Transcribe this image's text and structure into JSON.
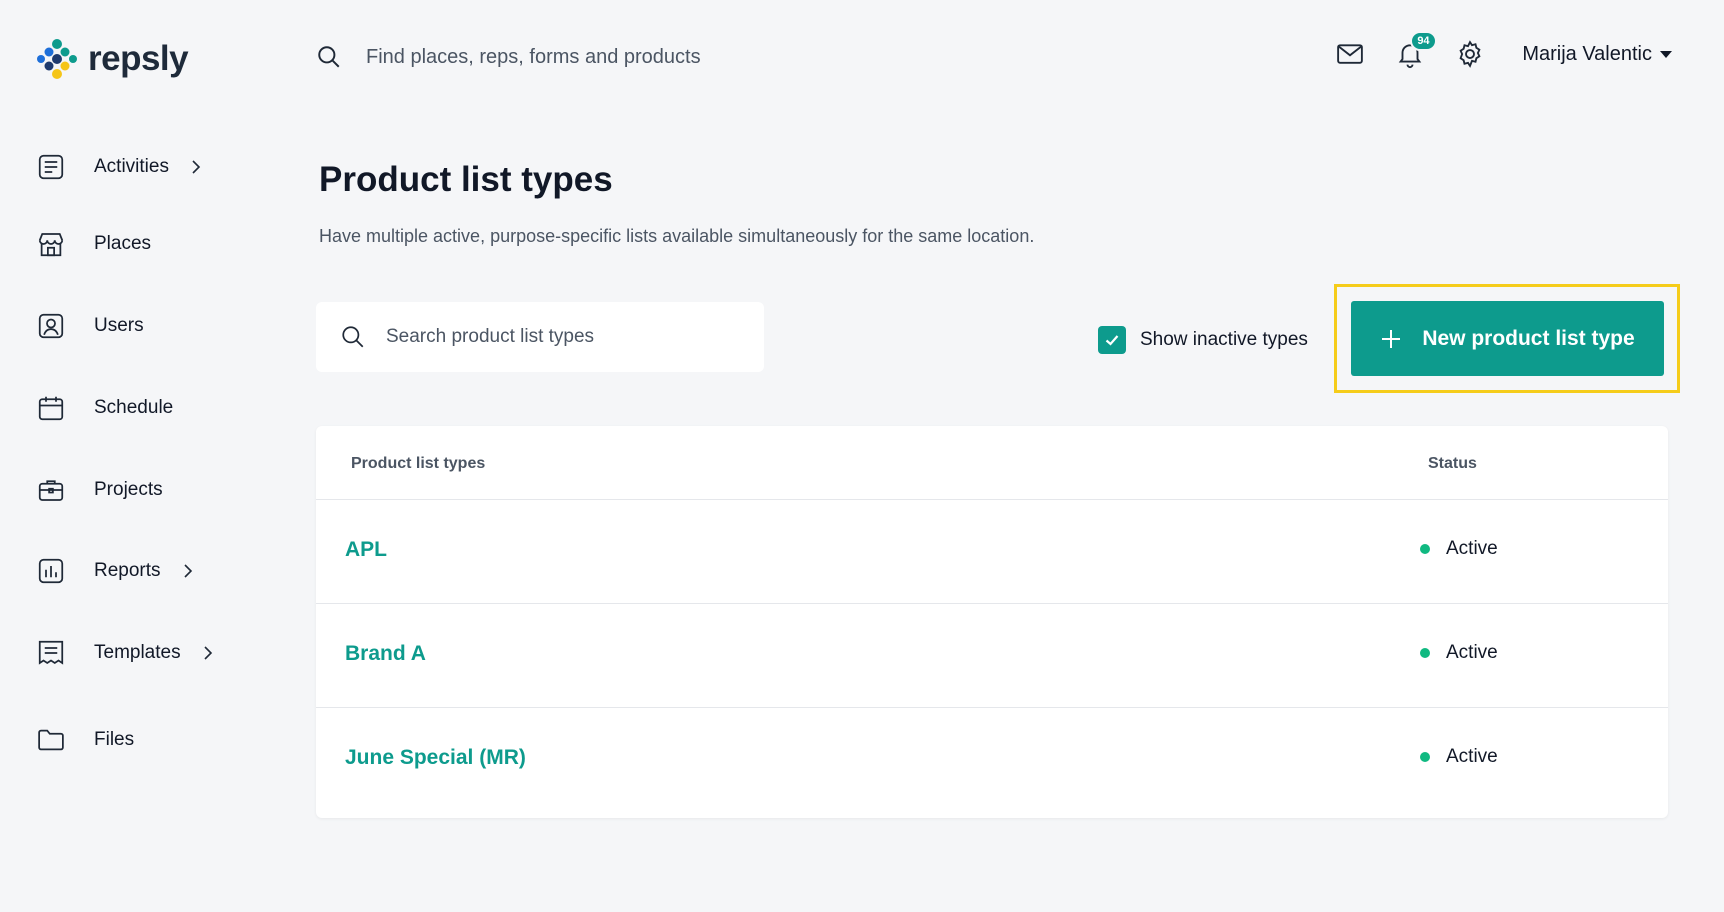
{
  "brand": {
    "name": "repsly"
  },
  "header": {
    "search_placeholder": "Find places, reps, forms and products",
    "notification_count": "94",
    "user_name": "Marija Valentic"
  },
  "sidebar": {
    "items": [
      {
        "label": "Activities",
        "icon": "activities-icon",
        "has_submenu": true
      },
      {
        "label": "Places",
        "icon": "store-icon",
        "has_submenu": false
      },
      {
        "label": "Users",
        "icon": "user-icon",
        "has_submenu": false
      },
      {
        "label": "Schedule",
        "icon": "calendar-icon",
        "has_submenu": false
      },
      {
        "label": "Projects",
        "icon": "briefcase-icon",
        "has_submenu": false
      },
      {
        "label": "Reports",
        "icon": "bar-chart-icon",
        "has_submenu": true
      },
      {
        "label": "Templates",
        "icon": "template-icon",
        "has_submenu": true
      },
      {
        "label": "Files",
        "icon": "folder-icon",
        "has_submenu": false
      }
    ]
  },
  "main": {
    "title": "Product list types",
    "description": "Have multiple active, purpose-specific lists available simultaneously for the same location.",
    "search_placeholder": "Search product list types",
    "show_inactive_label": "Show inactive types",
    "show_inactive_checked": true,
    "new_button_label": "New product list type",
    "table": {
      "columns": [
        "Product list types",
        "Status"
      ],
      "rows": [
        {
          "name": "APL",
          "status": "Active"
        },
        {
          "name": "Brand A",
          "status": "Active"
        },
        {
          "name": "June Special (MR)",
          "status": "Active"
        }
      ]
    }
  },
  "colors": {
    "accent": "#0d9b8d",
    "highlight": "#f5cc1a",
    "status_active": "#10b981"
  }
}
